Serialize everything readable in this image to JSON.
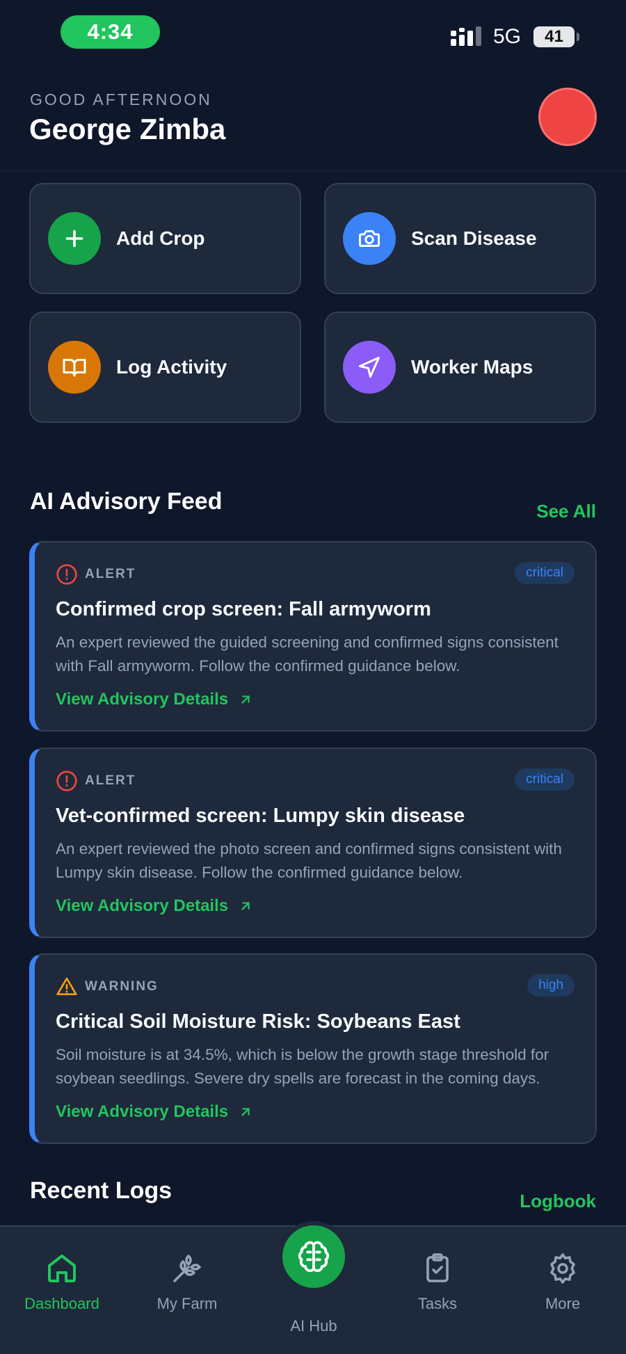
{
  "status": {
    "time": "4:34",
    "network": "5G",
    "battery": "41"
  },
  "header": {
    "greeting": "GOOD AFTERNOON",
    "name": "George Zimba"
  },
  "quick_actions": [
    {
      "label": "Add Crop",
      "icon": "plus-icon",
      "color": "#16a34a"
    },
    {
      "label": "Scan Disease",
      "icon": "camera-icon",
      "color": "#3b82f6"
    },
    {
      "label": "Log Activity",
      "icon": "book-icon",
      "color": "#d97706"
    },
    {
      "label": "Worker Maps",
      "icon": "navigation-icon",
      "color": "#8b5cf6"
    }
  ],
  "advisory": {
    "title": "AI Advisory Feed",
    "see_all": "See All",
    "items": [
      {
        "kind": "ALERT",
        "badge": "critical",
        "title": "Confirmed crop screen: Fall armyworm",
        "body": "An expert reviewed the guided screening and confirmed signs consistent with Fall armyworm. Follow the confirmed guidance below.",
        "link": "View Advisory Details"
      },
      {
        "kind": "ALERT",
        "badge": "critical",
        "title": "Vet-confirmed screen: Lumpy skin disease",
        "body": "An expert reviewed the photo screen and confirmed signs consistent with Lumpy skin disease. Follow the confirmed guidance below.",
        "link": "View Advisory Details"
      },
      {
        "kind": "WARNING",
        "badge": "high",
        "title": "Critical Soil Moisture Risk: Soybeans East",
        "body": "Soil moisture is at 34.5%, which is below the growth stage threshold for soybean seedlings. Severe dry spells are forecast in the coming days.",
        "link": "View Advisory Details"
      }
    ]
  },
  "recent_logs": {
    "title": "Recent Logs",
    "link": "Logbook"
  },
  "nav": {
    "dashboard": "Dashboard",
    "my_farm": "My Farm",
    "ai_hub": "AI Hub",
    "tasks": "Tasks",
    "more": "More"
  },
  "colors": {
    "accent": "#22c55e",
    "alert": "#ef4444",
    "warning": "#f59e0b",
    "badge": "#3b82f6"
  }
}
